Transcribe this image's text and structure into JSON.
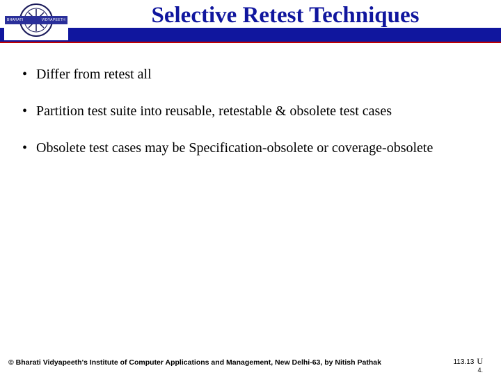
{
  "header": {
    "title": "Selective Retest Techniques",
    "logo": {
      "left": "BHARATI",
      "right": "VIDYAPEETH"
    }
  },
  "bullets": [
    "Differ from retest all",
    "Partition test suite into reusable, retestable & obsolete test cases",
    "Obsolete test cases may be Specification-obsolete or coverage-obsolete"
  ],
  "footer": {
    "copyright": "© Bharati Vidyapeeth's Institute of Computer Applications and Management, New Delhi-63, by  Nitish Pathak",
    "pagenum": "113.13",
    "u": "U",
    "sub": "4."
  }
}
